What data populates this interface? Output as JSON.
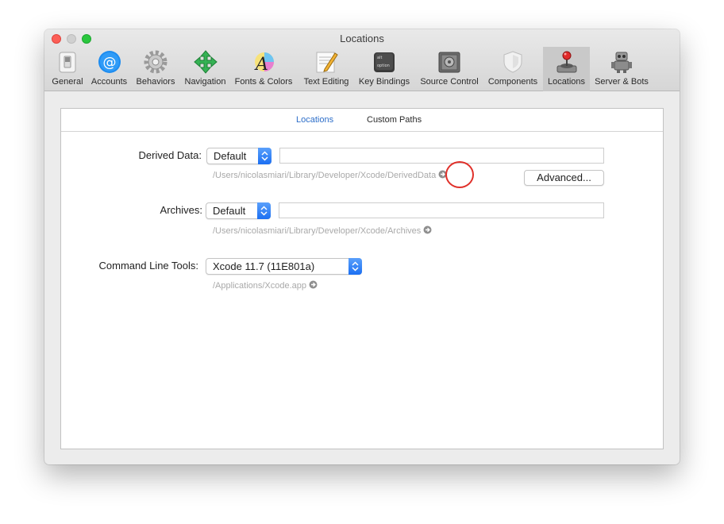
{
  "window": {
    "title": "Locations"
  },
  "toolbar": {
    "items": [
      {
        "label": "General",
        "icon": "general-switch-icon"
      },
      {
        "label": "Accounts",
        "icon": "at-sign-icon"
      },
      {
        "label": "Behaviors",
        "icon": "gear-icon"
      },
      {
        "label": "Navigation",
        "icon": "navigation-arrows-icon"
      },
      {
        "label": "Fonts & Colors",
        "icon": "font-palette-icon"
      },
      {
        "label": "Text Editing",
        "icon": "text-edit-pencil-icon"
      },
      {
        "label": "Key Bindings",
        "icon": "keyboard-key-icon"
      },
      {
        "label": "Source Control",
        "icon": "vault-icon"
      },
      {
        "label": "Components",
        "icon": "shield-icon"
      },
      {
        "label": "Locations",
        "icon": "joystick-icon",
        "active": true
      },
      {
        "label": "Server & Bots",
        "icon": "robot-icon"
      }
    ]
  },
  "tabs": [
    {
      "label": "Locations",
      "active": true
    },
    {
      "label": "Custom Paths",
      "active": false
    }
  ],
  "derived_data": {
    "label": "Derived Data:",
    "popup_value": "Default",
    "field_value": "",
    "path": "/Users/nicolasmiari/Library/Developer/Xcode/DerivedData",
    "advanced_button": "Advanced..."
  },
  "archives": {
    "label": "Archives:",
    "popup_value": "Default",
    "field_value": "",
    "path": "/Users/nicolasmiari/Library/Developer/Xcode/Archives"
  },
  "command_line_tools": {
    "label": "Command Line Tools:",
    "popup_value": "Xcode 11.7 (11E801a)",
    "path": "/Applications/Xcode.app"
  },
  "colors": {
    "accent": "#2d6ec9",
    "popup_blue": "#1b6ff2",
    "highlight_red": "#e0302a"
  }
}
